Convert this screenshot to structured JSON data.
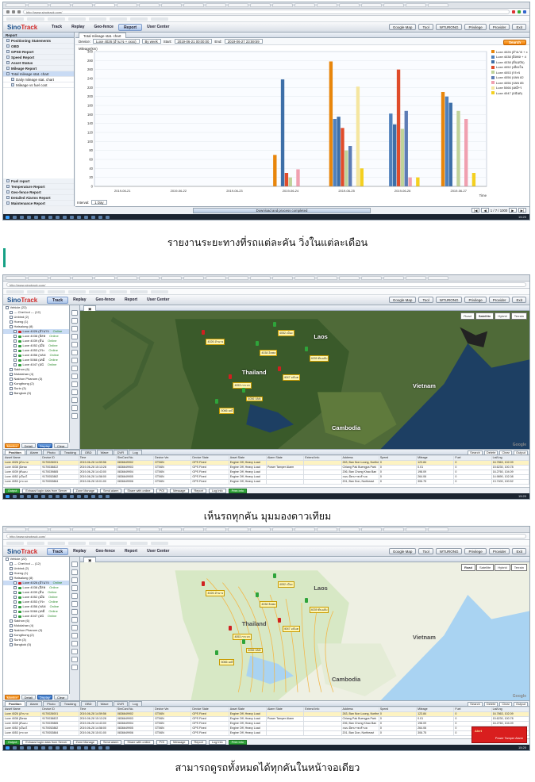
{
  "browser": {
    "address": "http://www.sinotrack.com/",
    "tab_count": 20
  },
  "app": {
    "logo_main": "Sino",
    "logo_accent": "Track",
    "menu": [
      "Track",
      "Replay",
      "Geo-fence",
      "Report",
      "User Center"
    ],
    "active_menu": "Report",
    "header_buttons": [
      "Google Map",
      "Tool",
      "WTURONG",
      "Privilege",
      "Provider",
      "Exit"
    ]
  },
  "panel1": {
    "sidebar_header": "Report",
    "sidebar_items": [
      {
        "label": "Positioning Statements",
        "type": "grp"
      },
      {
        "label": "OBD",
        "type": "grp"
      },
      {
        "label": "GPSD Report",
        "type": "grp"
      },
      {
        "label": "Speed Report",
        "type": "grp"
      },
      {
        "label": "Asset Status",
        "type": "grp"
      },
      {
        "label": "Mileage Report",
        "type": "grp"
      },
      {
        "label": "Total mileage stat. chart",
        "type": "sel"
      },
      {
        "label": "Daily mileage stat. chart",
        "type": "sub"
      },
      {
        "label": "Mileage vs fuel cost",
        "type": "sub"
      }
    ],
    "sidebar_bottom": [
      "Fuel report",
      "Temperature Report",
      "Geo-fence Report",
      "Detailed Alarms Report",
      "Maintenance Report"
    ],
    "tab_title": "Total mileage stat. chart",
    "filter": {
      "device_label": "Device:",
      "device_value": "Luxe 4026 (อำนาจ + xxxx)",
      "period_value": "By week",
      "start_label": "Start:",
      "start_value": "2019-06-21 00:00:00",
      "end_label": "End:",
      "end_value": "2019-06-27 23:59:59",
      "search_button": "Search"
    },
    "ylabel": "Mileage(km)",
    "interval_label": "Interval:",
    "interval_value": "1 Day",
    "progress_text": "Download and process completed",
    "progress_fraction": 1.0,
    "pager_text": "1 / 7 / 1000"
  },
  "chart_data": {
    "type": "bar",
    "ylabel": "Mileage(km)",
    "xlabel": "Time",
    "ylim": [
      0,
      300
    ],
    "yticks": [
      0,
      20,
      40,
      60,
      80,
      100,
      120,
      140,
      160,
      180,
      200,
      220,
      240,
      260,
      280,
      300
    ],
    "categories": [
      "2019-06-21",
      "2019-06-22",
      "2019-06-23",
      "2019-06-24",
      "2019-06-25",
      "2019-06-26",
      "2019-06-27"
    ],
    "series": [
      {
        "name": "Luxe 4026 (อำนาจ + x",
        "color": "#e8860c",
        "values": [
          0,
          0,
          0,
          70,
          278,
          0,
          210
        ]
      },
      {
        "name": "Luxe 4038 (อิลพล + 4",
        "color": "#4f81bd",
        "values": [
          0,
          0,
          0,
          0,
          150,
          162,
          200
        ]
      },
      {
        "name": "Luxe 4038 (ต้นฉบับ)",
        "color": "#3d6fa8",
        "values": [
          0,
          0,
          0,
          238,
          155,
          138,
          186
        ]
      },
      {
        "name": "Luxe 4052 (เมืองใน",
        "color": "#e04c2b",
        "values": [
          0,
          0,
          0,
          30,
          130,
          260,
          0
        ]
      },
      {
        "name": "Luxe 4053 (กระจ",
        "color": "#c0d39a",
        "values": [
          0,
          0,
          0,
          20,
          80,
          128,
          168
        ]
      },
      {
        "name": "Luxe 4056 (VAN 82",
        "color": "#5d7cb5",
        "values": [
          0,
          0,
          0,
          0,
          90,
          168,
          0
        ]
      },
      {
        "name": "Luxe 4056 (VAN 85",
        "color": "#f0a0b0",
        "values": [
          0,
          0,
          0,
          38,
          0,
          20,
          150
        ]
      },
      {
        "name": "Luxe 5066 (เคมี+ร",
        "color": "#f5e6a0",
        "values": [
          0,
          0,
          0,
          0,
          222,
          0,
          0
        ]
      },
      {
        "name": "Luxe 4047 (อนันต)",
        "color": "#f4d020",
        "values": [
          0,
          0,
          0,
          0,
          40,
          20,
          30
        ]
      }
    ]
  },
  "map": {
    "tree_items": [
      {
        "label": "Vehicle (22)",
        "lvl": 0
      },
      {
        "label": "--- Chet bot --- (12)",
        "lvl": 1
      },
      {
        "label": "Unbind (2)",
        "lvl": 1
      },
      {
        "label": "Hoeng (1)",
        "lvl": 1
      },
      {
        "label": "Hatsalung (8)",
        "lvl": 1
      },
      {
        "label": "Luxe 4026 (อำนาจ",
        "lvl": 2,
        "status": "Online",
        "sel": true
      },
      {
        "label": "Luxe 4038 (อิลพ",
        "lvl": 2,
        "status": "Online"
      },
      {
        "label": "Luxe 4039 (ต้น",
        "lvl": 2,
        "status": "Online"
      },
      {
        "label": "Luxe 4052 (เมือ",
        "lvl": 2,
        "status": "Online"
      },
      {
        "label": "Luxe 4053 (กระ",
        "lvl": 2,
        "status": "Online"
      },
      {
        "label": "Luxe 4056 (VAN",
        "lvl": 2,
        "status": "Online"
      },
      {
        "label": "Luxe 5066 (เคมี",
        "lvl": 2,
        "status": "Online"
      },
      {
        "label": "Luxe 4047 (อนั",
        "lvl": 2,
        "status": "Online"
      },
      {
        "label": "Sakhon (6)",
        "lvl": 1
      },
      {
        "label": "Mukdahan (4)",
        "lvl": 1
      },
      {
        "label": "Nakhon Phanom (3)",
        "lvl": 1
      },
      {
        "label": "Kongthong (2)",
        "lvl": 1
      },
      {
        "label": "Surin (3)",
        "lvl": 1
      },
      {
        "label": "Bangkok (5)",
        "lvl": 1
      }
    ],
    "tree_buttons": [
      "Monitor",
      "Detail",
      "Display",
      "Clear"
    ],
    "map_types": [
      "Road",
      "Satellite",
      "Hybrid",
      "Terrain"
    ],
    "country_labels": [
      "Thailand",
      "Vietnam",
      "Cambodia",
      "Laos"
    ],
    "vehicle_labels": [
      "4026 อำนาจ",
      "4038 อิลพล",
      "4052 เมือง",
      "4053 กระจก",
      "4056 VAN",
      "5066 เคมี",
      "4047 อนันต",
      "4039 ต้นฉบับ"
    ],
    "google": "Google",
    "grid_tabs": [
      "Position",
      "Alarm",
      "Photo",
      "Tracking",
      "OBD",
      "Wave",
      "DVR",
      "Log"
    ],
    "grid_tools": [
      "Search",
      "Delete",
      "Clear",
      "Output"
    ],
    "grid_columns": [
      "Asset Name",
      "Device ID",
      "Time",
      "SimCard No.",
      "Device Ver.",
      "Device State",
      "Asset State",
      "Alarm State",
      "Extend Info",
      "Address",
      "Speed",
      "Mileage",
      "Fuel",
      "Lat/Lng"
    ],
    "grid_rows": [
      [
        "Luxe 4026 (อำนาจ",
        "9170026001",
        "2019-06-28 14:59:56",
        "0836649902",
        "GT06N",
        "GPS Fixed",
        "Engine Off, Heavy Load",
        "",
        "",
        "263, Ban Non Loong, Northeast",
        "0",
        "123.84",
        "0",
        "16.7863, 102.09"
      ],
      [
        "Luxe 4038 (อิลพล",
        "9170038822",
        "2019-06-28 15:13:28",
        "0836649903",
        "GT06N",
        "GPS Fixed",
        "Engine Off, Heavy Load",
        "Power Tamper Alarm",
        "",
        "Chiang Pak Buengpa Park",
        "0",
        "0.01",
        "0",
        "15.6230, 100.78"
      ],
      [
        "Luxe 4039 (ต้นฉบ",
        "9170039885",
        "2019-06-28 14:43:00",
        "0836649904",
        "GT06N",
        "GPS Fixed",
        "Engine Off, Heavy Load",
        "",
        "",
        "206, Ban Chong Khao Ban",
        "0",
        "198.09",
        "0",
        "16.2760, 104.09"
      ],
      [
        "Luxe 4052 (เมืองใ",
        "9170052882",
        "2019-06-28 14:58:00",
        "0836649905",
        "GT06N",
        "GPS Fixed",
        "Engine Off, Heavy Load",
        "",
        "",
        "ถนน มิตรภาพ ตำบล",
        "0",
        "264.06",
        "0",
        "14.9890, 102.08"
      ],
      [
        "Luxe 4053 (กระจก",
        "9170053884",
        "2019-06-28 15:01:00",
        "0836649906",
        "GT06N",
        "GPS Fixed",
        "Engine Off, Heavy Load",
        "",
        "",
        "201, Ban Don, Northeast",
        "0",
        "306.75",
        "0",
        "13.7400, 100.52"
      ]
    ],
    "grid_footer": [
      "Output",
      "Exhaust login data from Server",
      "Zone Manage",
      "Send alarm",
      "Share with online",
      "POI",
      "Message",
      "Report",
      "Log Info",
      "Print Info"
    ],
    "alert_title": "Alert",
    "alert_msg": "Power Tamper Alarm"
  },
  "captions": {
    "cap1": "รายงานระยะทางที่รถแต่ละคัน วิ่งในแต่ละเดือน",
    "cap2": "เห็นรถทุกคัน มุมมองดาวเทียม",
    "cap3": "สามารถดูรถทั้งหมดได้ทุกคันในหน้าจอเดียว"
  },
  "taskbar_time": "15:20"
}
